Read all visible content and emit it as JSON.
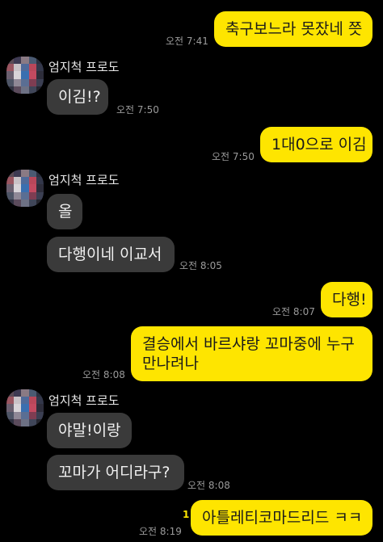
{
  "chat": {
    "messages": [
      {
        "id": "m1",
        "side": "mine",
        "text": "축구보느라 못잤네 쯧",
        "time": "오전 7:41"
      },
      {
        "id": "m2",
        "side": "theirs",
        "sender": "엄지척 프로도",
        "text": "이김!?",
        "time": "오전 7:50"
      },
      {
        "id": "m3",
        "side": "mine",
        "text": "1대0으로 이김",
        "time": "오전 7:50"
      },
      {
        "id": "m4",
        "side": "theirs",
        "sender": "엄지척 프로도",
        "text": "올"
      },
      {
        "id": "m5",
        "side": "theirs",
        "text": "다행이네 이교서",
        "time": "오전 8:05"
      },
      {
        "id": "m6",
        "side": "mine",
        "text": "다행!",
        "time": "오전 8:07"
      },
      {
        "id": "m7",
        "side": "mine",
        "text_line1": "결승에서 바르샤랑 꼬마중에 누구",
        "text_line2": "만나려나",
        "time": "오전 8:08"
      },
      {
        "id": "m8",
        "side": "theirs",
        "sender": "엄지척 프로도",
        "text": "야말!이랑"
      },
      {
        "id": "m9",
        "side": "theirs",
        "text": "꼬마가 어디라구?",
        "time": "오전 8:08"
      },
      {
        "id": "m10",
        "side": "mine",
        "text": "아틀레티코마드리드 ㅋㅋ",
        "time": "오전 8:19",
        "unread": "1"
      }
    ]
  },
  "colors": {
    "background": "#000000",
    "mine_bubble": "#FEE500",
    "theirs_bubble": "#3A3A3A",
    "timestamp": "#9A9A9A"
  }
}
